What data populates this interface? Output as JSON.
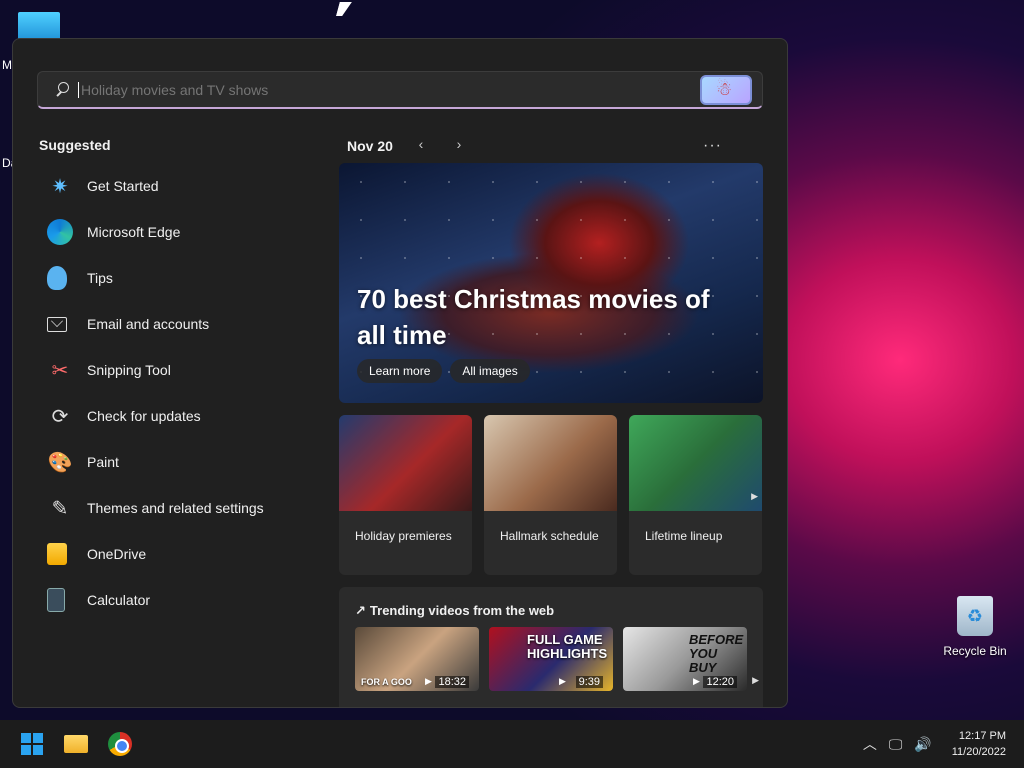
{
  "desktop": {
    "edge_letter_1": "M",
    "edge_letter_2": "Da",
    "recycle_bin_label": "Recycle Bin"
  },
  "search": {
    "placeholder": "Holiday movies and TV shows",
    "value": ""
  },
  "suggested": {
    "title": "Suggested",
    "items": [
      {
        "label": "Get Started",
        "icon": "get-started-icon"
      },
      {
        "label": "Microsoft Edge",
        "icon": "edge-icon"
      },
      {
        "label": "Tips",
        "icon": "tips-icon"
      },
      {
        "label": "Email and accounts",
        "icon": "mail-icon"
      },
      {
        "label": "Snipping Tool",
        "icon": "snipping-tool-icon"
      },
      {
        "label": "Check for updates",
        "icon": "update-icon"
      },
      {
        "label": "Paint",
        "icon": "paint-icon"
      },
      {
        "label": "Themes and related settings",
        "icon": "brush-icon"
      },
      {
        "label": "OneDrive",
        "icon": "onedrive-icon"
      },
      {
        "label": "Calculator",
        "icon": "calculator-icon"
      }
    ]
  },
  "feed": {
    "date": "Nov 20",
    "prev_glyph": "‹",
    "next_glyph": "›",
    "more_glyph": "···",
    "hero": {
      "headline": "70 best Christmas movies of all time",
      "learn_more": "Learn more",
      "all_images": "All images"
    },
    "cards": [
      {
        "caption": "Holiday premieres"
      },
      {
        "caption": "Hallmark schedule"
      },
      {
        "caption": "Lifetime lineup"
      }
    ],
    "trending": {
      "title": "Trending videos from the web",
      "videos": [
        {
          "overlay": "FOR A GOO",
          "duration": "18:32"
        },
        {
          "overlay": "FULL GAME HIGHLIGHTS",
          "duration": "9:39"
        },
        {
          "overlay": "BEFORE YOU BUY",
          "duration": "12:20"
        }
      ]
    }
  },
  "taskbar": {
    "time": "12:17 PM",
    "date": "11/20/2022"
  },
  "colors": {
    "panel_bg": "#202020",
    "accent_underline": "#c6a7d8",
    "windows_blue": "#2aa3f0"
  }
}
